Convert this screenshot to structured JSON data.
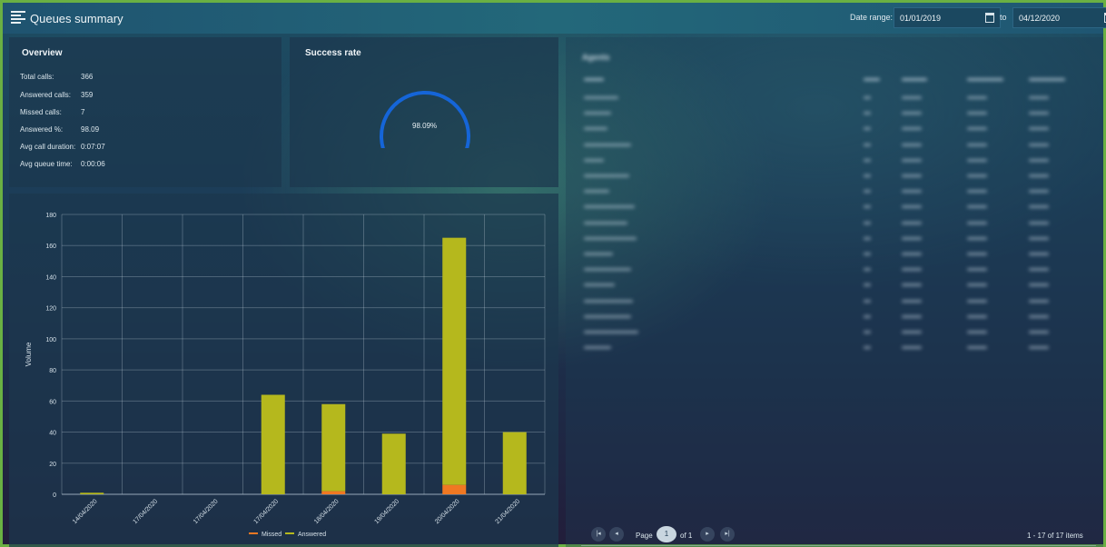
{
  "header": {
    "title": "Queues summary",
    "date_range_label": "Date range:",
    "date_from": "01/01/2019",
    "to_label": "to",
    "date_to": "04/12/2020"
  },
  "overview": {
    "title": "Overview",
    "rows": [
      {
        "label": "Total calls:",
        "value": "366"
      },
      {
        "label": "Answered calls:",
        "value": "359"
      },
      {
        "label": "Missed calls:",
        "value": "7"
      },
      {
        "label": "Answered %:",
        "value": "98.09"
      },
      {
        "label": "Avg call duration:",
        "value": "0:07:07"
      },
      {
        "label": "Avg queue time:",
        "value": "0:00:06"
      }
    ]
  },
  "success_rate": {
    "title": "Success rate",
    "value_text": "98.09%",
    "fraction": 0.9809
  },
  "agents": {
    "title": "Agents",
    "pager": {
      "page_label": "Page",
      "page": "1",
      "of_label": "of 1",
      "items_text": "1 - 17 of 17 items"
    }
  },
  "colors": {
    "answered": "#b5b81d",
    "missed": "#f07823",
    "gauge": "#1565d8"
  },
  "chart_data": {
    "type": "bar",
    "stacked": true,
    "categories": [
      "14/04/2020",
      "17/04/2020",
      "17/04/2020",
      "17/04/2020",
      "18/04/2020",
      "19/04/2020",
      "20/04/2020",
      "21/04/2020"
    ],
    "series": [
      {
        "name": "Missed",
        "values": [
          0,
          0,
          0,
          0,
          2,
          0,
          6,
          0
        ]
      },
      {
        "name": "Answered",
        "values": [
          1,
          0,
          0,
          64,
          56,
          39,
          159,
          40
        ]
      }
    ],
    "ylabel": "Volume",
    "ylim": [
      0,
      180
    ],
    "yticks": [
      0,
      20,
      40,
      60,
      80,
      100,
      120,
      140,
      160,
      180
    ],
    "grid": true,
    "legend": "bottom"
  }
}
